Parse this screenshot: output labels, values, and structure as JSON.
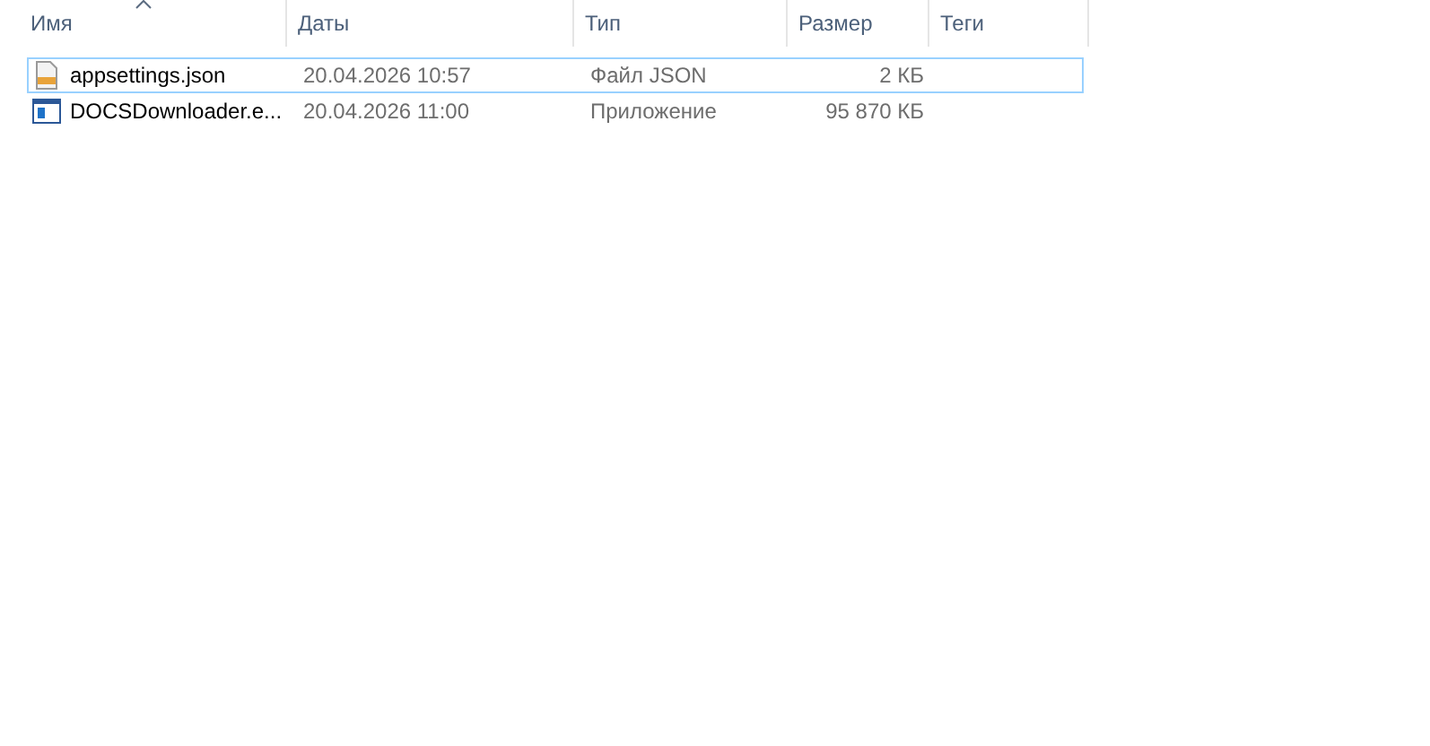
{
  "columns": [
    {
      "label": "Имя",
      "sorted": true
    },
    {
      "label": "Даты",
      "sorted": false
    },
    {
      "label": "Тип",
      "sorted": false
    },
    {
      "label": "Размер",
      "sorted": false
    },
    {
      "label": "Теги",
      "sorted": false
    }
  ],
  "rows": [
    {
      "kind": "json",
      "name": "appsettings.json",
      "date": "20.04.2026 10:57",
      "type": "Файл JSON",
      "size": "2 КБ",
      "focused": true
    },
    {
      "kind": "exe",
      "name": "DOCSDownloader.e...",
      "date": "20.04.2026 11:00",
      "type": "Приложение",
      "size": "95 870 КБ",
      "focused": false
    }
  ]
}
